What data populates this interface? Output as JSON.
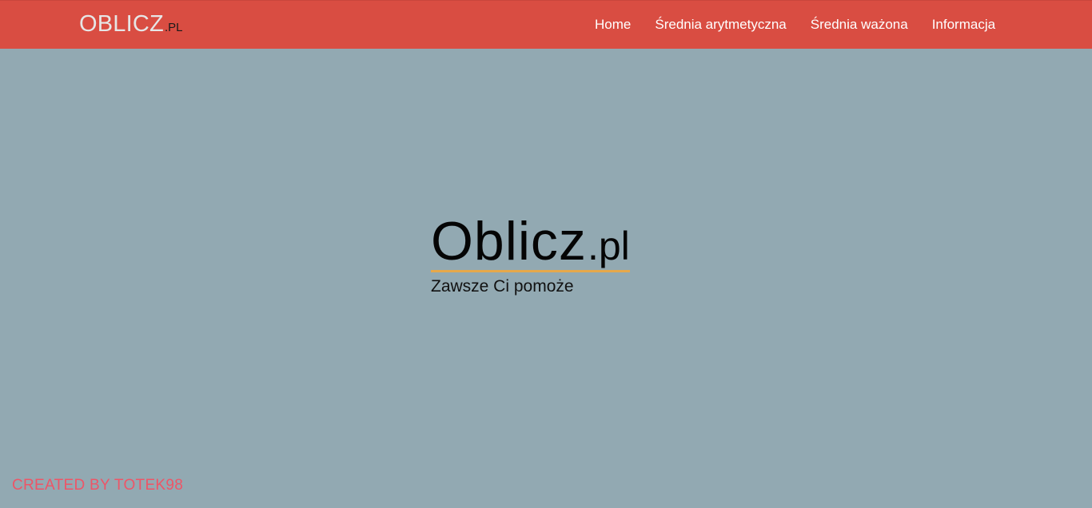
{
  "header": {
    "brand": {
      "main": "OBLICZ",
      "suffix": ".PL"
    },
    "nav": [
      {
        "label": "Home"
      },
      {
        "label": "Średnia arytmetyczna"
      },
      {
        "label": "Średnia ważona"
      },
      {
        "label": "Informacja"
      }
    ]
  },
  "hero": {
    "title_main": "Oblicz",
    "title_suffix": ".pl",
    "subtitle": "Zawsze Ci pomoże"
  },
  "footer": {
    "credit": "CREATED BY TOTEK98"
  },
  "colors": {
    "header_background": "#d94d42",
    "page_background": "#92a9b2",
    "title_underline": "#e6a84a",
    "credit_text": "#ee5567"
  }
}
